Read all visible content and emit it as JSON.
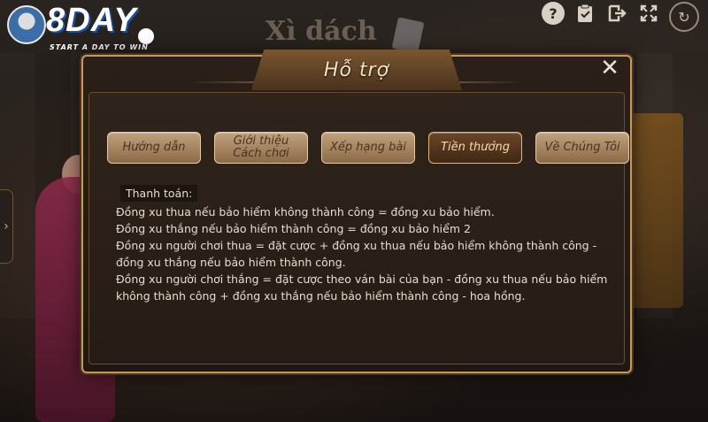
{
  "background": {
    "game_title": "Xì dách"
  },
  "logo": {
    "brand": "8DAY",
    "tagline": "START A DAY TO WIN"
  },
  "topbar": {
    "icons": [
      "help-icon",
      "checklist-icon",
      "exit-icon",
      "fullscreen-icon",
      "refresh-icon"
    ],
    "help_glyph": "?"
  },
  "modal": {
    "title": "Hỗ trợ",
    "close_glyph": "✕",
    "tabs": [
      {
        "label": "Hướng dẫn"
      },
      {
        "label": "Giới thiệu\nCách chơi"
      },
      {
        "label": "Xếp hạng bài"
      },
      {
        "label": "Tiền thưởng",
        "active": true
      },
      {
        "label": "Về Chúng Tôi"
      }
    ],
    "content": {
      "section": "Thanh toán:",
      "lines": [
        "Đồng xu thua nếu bảo hiểm không thành công = đồng xu bảo hiểm.",
        "Đồng xu thắng nếu bảo hiểm thành công = đồng xu bảo hiểm 2",
        "Đồng xu người chơi thua = đặt cược + đồng xu thua nếu bảo hiểm không thành công -",
        "đồng xu thắng nếu bảo hiểm thành công.",
        "Đồng xu người chơi thắng = đặt cược theo ván bài của bạn - đồng xu thua nếu bảo hiểm",
        "không thành công + đồng xu thắng nếu bảo hiểm thành công - hoa hồng."
      ]
    }
  },
  "colors": {
    "accent_gold": "#c79a5a",
    "active_tab_text": "#f7d9a6",
    "body_text": "#e6ddd0"
  }
}
